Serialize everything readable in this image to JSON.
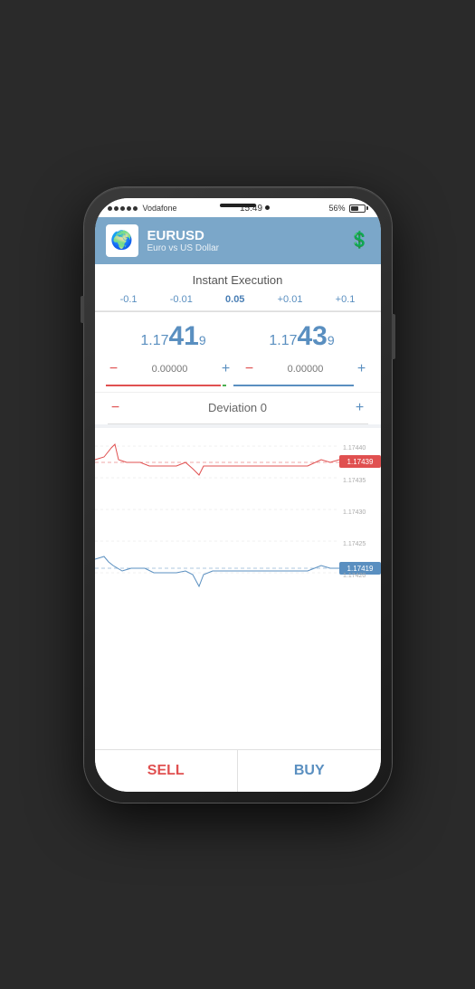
{
  "status_bar": {
    "carrier": "Vodafone",
    "time": "15:49",
    "signal_dots": 5,
    "battery_percent": "56%"
  },
  "header": {
    "symbol": "EURUSD",
    "description": "Euro vs US Dollar",
    "logo_emoji": "🌍"
  },
  "execution": {
    "title": "Instant Execution",
    "adjustments": [
      "-0.1",
      "-0.01",
      "0.05",
      "+0.01",
      "+0.1"
    ],
    "active_adj": "0.05",
    "bid_prefix": "1.17",
    "bid_main": "41",
    "bid_super": "9",
    "ask_prefix": "1.17",
    "ask_main": "43",
    "ask_super": "9",
    "sell_input": "0.00000",
    "buy_input": "0.00000",
    "deviation_label": "Deviation",
    "deviation_value": "0"
  },
  "chart": {
    "price_labels": [
      "1.17440",
      "1.17435",
      "1.17430",
      "1.17425",
      "1.17420"
    ],
    "bid_tag": "1.17439",
    "ask_tag": "1.17419"
  },
  "actions": {
    "sell_label": "SELL",
    "buy_label": "BUY"
  }
}
